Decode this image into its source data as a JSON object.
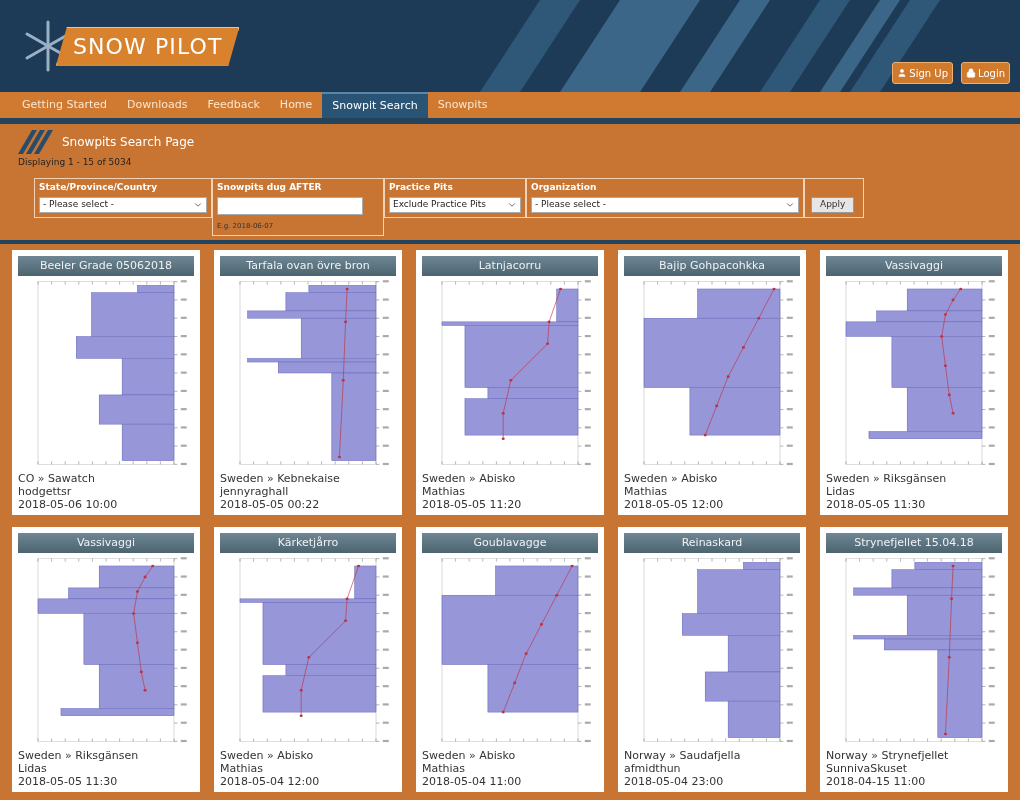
{
  "logo": {
    "text": "SNOW PILOT"
  },
  "header_buttons": [
    {
      "label": "Sign Up",
      "kind": "user"
    },
    {
      "label": "Login",
      "kind": "lock"
    }
  ],
  "nav": [
    {
      "label": "Getting Started",
      "selected": false
    },
    {
      "label": "Downloads",
      "selected": false
    },
    {
      "label": "Feedback",
      "selected": false
    },
    {
      "label": "Home",
      "selected": false
    },
    {
      "label": "Snowpit Search",
      "selected": true
    },
    {
      "label": "Snowpits",
      "selected": false
    }
  ],
  "search": {
    "title": "Snowpits Search Page",
    "count": "Displaying 1 - 15 of 5034",
    "filters": [
      {
        "kind": "select",
        "label": "State/Province/Country",
        "value": "- Please select -"
      },
      {
        "kind": "date",
        "label": "Snowpits dug AFTER",
        "hint": "E.g. 2018-06-07"
      },
      {
        "kind": "select",
        "label": "Practice Pits",
        "value": "Exclude Practice Pits"
      },
      {
        "kind": "select",
        "label": "Organization",
        "value": "- Please select -"
      }
    ],
    "apply": "Apply"
  },
  "snowpits": [
    {
      "title": "Beeler Grade 05062018",
      "location": "CO » Sawatch",
      "user": "hodgettsr",
      "date": "2018-05-06 10:00"
    },
    {
      "title": "Tarfala ovan övre bron",
      "location": "Sweden » Kebnekaise",
      "user": "jennyraghall",
      "date": "2018-05-05 00:22"
    },
    {
      "title": "Latnjacorru",
      "location": "Sweden » Abisko",
      "user": "Mathias",
      "date": "2018-05-05 11:20"
    },
    {
      "title": "Bajip Gohpacohkka",
      "location": "Sweden » Abisko",
      "user": "Mathias",
      "date": "2018-05-05 12:00"
    },
    {
      "title": "Vassivaggi",
      "location": "Sweden » Riksgänsen",
      "user": "Lidas",
      "date": "2018-05-05 11:30"
    },
    {
      "title": "Vassivaggi",
      "location": "Sweden » Riksgänsen",
      "user": "Lidas",
      "date": "2018-05-05 11:30"
    },
    {
      "title": "Kärketjårro",
      "location": "Sweden » Abisko",
      "user": "Mathias",
      "date": "2018-05-04 12:00"
    },
    {
      "title": "Goublavagge",
      "location": "Sweden » Abisko",
      "user": "Mathias",
      "date": "2018-05-04 11:00"
    },
    {
      "title": "Reinaskard",
      "location": "Norway » Saudafjella",
      "user": "afmidthun",
      "date": "2018-05-04 23:00"
    },
    {
      "title": "Strynefjellet 15.04.18",
      "location": "Norway » Strynefjellet",
      "user": "SunnivaSkuset",
      "date": "2018-04-15 11:00"
    }
  ]
}
